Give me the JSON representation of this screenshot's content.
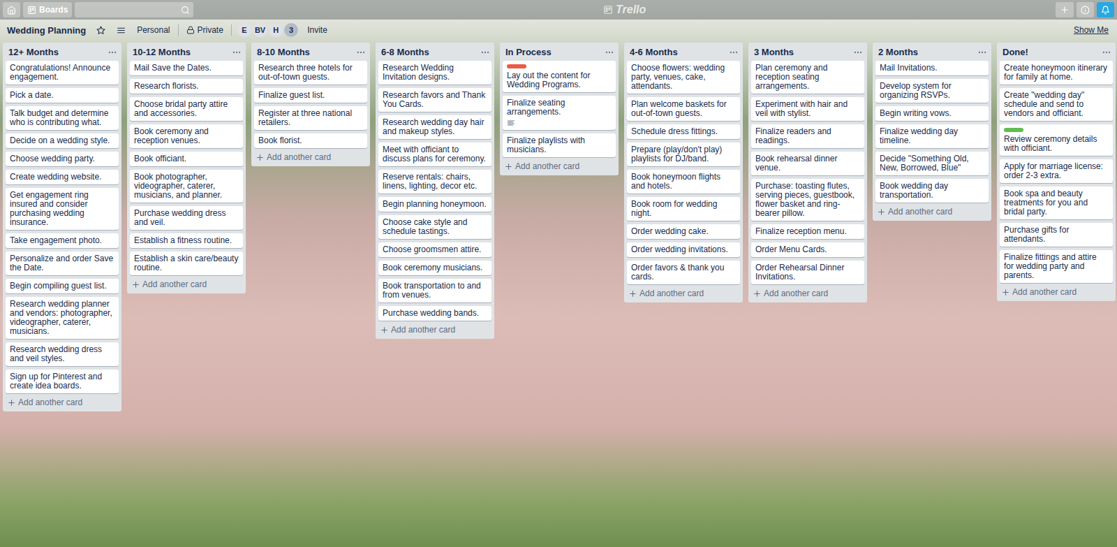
{
  "topbar": {
    "boards_label": "Boards",
    "logo": "Trello"
  },
  "board": {
    "title": "Wedding Planning",
    "starred": false,
    "team": "Personal",
    "visibility": "Private",
    "members": [
      {
        "initials": "E"
      },
      {
        "initials": "BV"
      },
      {
        "initials": "H"
      }
    ],
    "member_count": "3",
    "invite": "Invite",
    "menu_link": "Show Me"
  },
  "lists": [
    {
      "title": "12+ Months",
      "add_label": "Add another card",
      "cards": [
        {
          "text": "Congratulations! Announce engagement.",
          "labels": [],
          "description": false
        },
        {
          "text": "Pick a date.",
          "labels": [],
          "description": false
        },
        {
          "text": "Talk budget and determine who is contributing what.",
          "labels": [],
          "description": false
        },
        {
          "text": "Decide on a wedding style.",
          "labels": [],
          "description": false
        },
        {
          "text": "Choose wedding party.",
          "labels": [],
          "description": false
        },
        {
          "text": "Create wedding website.",
          "labels": [],
          "description": false
        },
        {
          "text": "Get engagement ring insured and consider purchasing wedding insurance.",
          "labels": [],
          "description": false
        },
        {
          "text": "Take engagement photo.",
          "labels": [],
          "description": false
        },
        {
          "text": "Personalize and order Save the Date.",
          "labels": [],
          "description": false
        },
        {
          "text": "Begin compiling guest list.",
          "labels": [],
          "description": false
        },
        {
          "text": "Research wedding planner and vendors: photographer, videographer, caterer, musicians.",
          "labels": [],
          "description": false
        },
        {
          "text": "Research wedding dress and veil styles.",
          "labels": [],
          "description": false
        },
        {
          "text": "Sign up for Pinterest and create idea boards.",
          "labels": [],
          "description": false
        }
      ]
    },
    {
      "title": "10-12 Months",
      "add_label": "Add another card",
      "cards": [
        {
          "text": "Mail Save the Dates.",
          "labels": [],
          "description": false
        },
        {
          "text": "Research florists.",
          "labels": [],
          "description": false
        },
        {
          "text": "Choose bridal party attire and accessories.",
          "labels": [],
          "description": false
        },
        {
          "text": "Book ceremony and reception venues.",
          "labels": [],
          "description": false
        },
        {
          "text": "Book officiant.",
          "labels": [],
          "description": false
        },
        {
          "text": "Book photographer, videographer, caterer, musicians, and planner.",
          "labels": [],
          "description": false
        },
        {
          "text": "Purchase wedding dress and veil.",
          "labels": [],
          "description": false
        },
        {
          "text": "Establish a fitness routine.",
          "labels": [],
          "description": false
        },
        {
          "text": "Establish a skin care/beauty routine.",
          "labels": [],
          "description": false
        }
      ]
    },
    {
      "title": "8-10 Months",
      "add_label": "Add another card",
      "cards": [
        {
          "text": "Research three hotels for out-of-town guests.",
          "labels": [],
          "description": false
        },
        {
          "text": "Finalize guest list.",
          "labels": [],
          "description": false
        },
        {
          "text": "Register at three national retailers.",
          "labels": [],
          "description": false
        },
        {
          "text": "Book florist.",
          "labels": [],
          "description": false
        }
      ]
    },
    {
      "title": "6-8 Months",
      "add_label": "Add another card",
      "cards": [
        {
          "text": "Research Wedding Invitation designs.",
          "labels": [],
          "description": false
        },
        {
          "text": "Research favors and Thank You Cards.",
          "labels": [],
          "description": false
        },
        {
          "text": "Research wedding day hair and makeup styles.",
          "labels": [],
          "description": false
        },
        {
          "text": "Meet with officiant to discuss plans for ceremony.",
          "labels": [],
          "description": false
        },
        {
          "text": "Reserve rentals: chairs, linens, lighting, decor etc.",
          "labels": [],
          "description": false
        },
        {
          "text": "Begin planning honeymoon.",
          "labels": [],
          "description": false
        },
        {
          "text": "Choose cake style and schedule tastings.",
          "labels": [],
          "description": false
        },
        {
          "text": "Choose groomsmen attire.",
          "labels": [],
          "description": false
        },
        {
          "text": "Book ceremony musicians.",
          "labels": [],
          "description": false
        },
        {
          "text": "Book transportation to and from venues.",
          "labels": [],
          "description": false
        },
        {
          "text": "Purchase wedding bands.",
          "labels": [],
          "description": false
        }
      ]
    },
    {
      "title": "In Process",
      "add_label": "Add another card",
      "cards": [
        {
          "text": "Lay out the content for Wedding Programs.",
          "labels": [
            {
              "color": "#eb5a46"
            }
          ],
          "description": false
        },
        {
          "text": "Finalize seating arrangements.",
          "labels": [],
          "description": true
        },
        {
          "text": "Finalize playlists with musicians.",
          "labels": [],
          "description": false
        }
      ]
    },
    {
      "title": "4-6 Months",
      "add_label": "Add another card",
      "cards": [
        {
          "text": "Choose flowers: wedding party, venues, cake, attendants.",
          "labels": [],
          "description": false
        },
        {
          "text": "Plan welcome baskets for out-of-town guests.",
          "labels": [],
          "description": false
        },
        {
          "text": "Schedule dress fittings.",
          "labels": [],
          "description": false
        },
        {
          "text": "Prepare (play/don't play) playlists for DJ/band.",
          "labels": [],
          "description": false
        },
        {
          "text": "Book honeymoon flights and hotels.",
          "labels": [],
          "description": false
        },
        {
          "text": "Book room for wedding night.",
          "labels": [],
          "description": false
        },
        {
          "text": "Order wedding cake.",
          "labels": [],
          "description": false
        },
        {
          "text": "Order wedding invitations.",
          "labels": [],
          "description": false
        },
        {
          "text": "Order favors & thank you cards.",
          "labels": [],
          "description": false
        }
      ]
    },
    {
      "title": "3 Months",
      "add_label": "Add another card",
      "cards": [
        {
          "text": "Plan ceremony and reception seating arrangements.",
          "labels": [],
          "description": false
        },
        {
          "text": "Experiment with hair and veil with stylist.",
          "labels": [],
          "description": false
        },
        {
          "text": "Finalize readers and readings.",
          "labels": [],
          "description": false
        },
        {
          "text": "Book rehearsal dinner venue.",
          "labels": [],
          "description": false
        },
        {
          "text": "Purchase: toasting flutes, serving pieces, guestbook, flower basket and ring-bearer pillow.",
          "labels": [],
          "description": false
        },
        {
          "text": "Finalize reception menu.",
          "labels": [],
          "description": false
        },
        {
          "text": "Order Menu Cards.",
          "labels": [],
          "description": false
        },
        {
          "text": "Order Rehearsal Dinner Invitations.",
          "labels": [],
          "description": false
        }
      ]
    },
    {
      "title": "2 Months",
      "add_label": "Add another card",
      "cards": [
        {
          "text": "Mail Invitations.",
          "labels": [],
          "description": false
        },
        {
          "text": "Develop system for organizing RSVPs.",
          "labels": [],
          "description": false
        },
        {
          "text": "Begin writing vows.",
          "labels": [],
          "description": false
        },
        {
          "text": "Finalize wedding day timeline.",
          "labels": [],
          "description": false
        },
        {
          "text": "Decide \"Something Old, New, Borrowed, Blue\"",
          "labels": [],
          "description": false
        },
        {
          "text": "Book wedding day transportation.",
          "labels": [],
          "description": false
        }
      ]
    },
    {
      "title": "Done!",
      "add_label": "Add another card",
      "cards": [
        {
          "text": "Create honeymoon itinerary for family at home.",
          "labels": [],
          "description": false
        },
        {
          "text": "Create \"wedding day\" schedule and send to vendors and officiant.",
          "labels": [],
          "description": false
        },
        {
          "text": "Review ceremony details with officiant.",
          "labels": [
            {
              "color": "#61bd4f"
            }
          ],
          "description": false
        },
        {
          "text": "Apply for marriage license: order 2-3 extra.",
          "labels": [],
          "description": false
        },
        {
          "text": "Book spa and beauty treatments for you and bridal party.",
          "labels": [],
          "description": false
        },
        {
          "text": "Purchase gifts for attendants.",
          "labels": [],
          "description": false
        },
        {
          "text": "Finalize fittings and attire for wedding party and parents.",
          "labels": [],
          "description": false
        }
      ]
    }
  ]
}
